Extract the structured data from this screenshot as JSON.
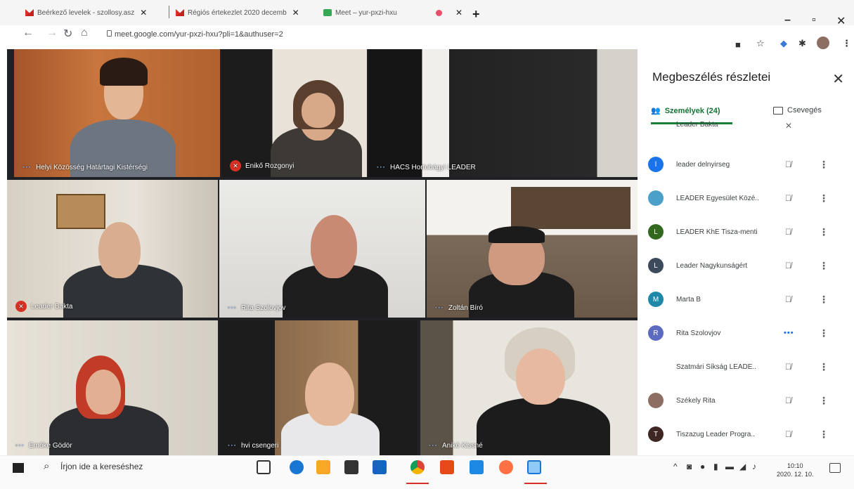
{
  "browser": {
    "tabs": [
      {
        "title": "Beérkező levelek - szollosy.asz",
        "icon": "gmail-icon"
      },
      {
        "title": "Régiós értekezlet 2020 decemb",
        "icon": "gmail-icon"
      },
      {
        "title": "Meet – yur-pxzi-hxu",
        "icon": "meet-icon"
      }
    ],
    "close_glyph": "✕",
    "new_tab_glyph": "+",
    "url": "meet.google.com/yur-pxzi-hxu?pli=1&authuser=2",
    "window_controls": [
      "–",
      "▫",
      "✕"
    ]
  },
  "meet": {
    "tiles": [
      {
        "name": "Helyi Közösség Határtagi Kistérségi",
        "indicator": "dots"
      },
      {
        "name": "Enikő Rozgonyi",
        "indicator": "muted"
      },
      {
        "name": "HACS Hortobágyi LEADER",
        "indicator": "dots"
      },
      {
        "name": "Leader Bakta",
        "indicator": "muted"
      },
      {
        "name": "Rita Szolovjov",
        "indicator": "dots"
      },
      {
        "name": "Zoltán Bíró",
        "indicator": "dots"
      },
      {
        "name": "Emőke Gödör",
        "indicator": "dots"
      },
      {
        "name": "hvi csengeri",
        "indicator": "dots"
      },
      {
        "name": "Anikó Kissné",
        "indicator": "dots"
      }
    ],
    "panel": {
      "title": "Megbeszélés részletei",
      "close_glyph": "✕",
      "tab_people": "Személyek (24)",
      "tab_chat": "Csevegés",
      "participants": [
        {
          "name": "Leader Bakta",
          "initial": "",
          "color": "#d93025",
          "status": "muted"
        },
        {
          "name": "leader delnyirseg",
          "initial": "l",
          "color": "#1a73e8",
          "status": "muted"
        },
        {
          "name": "LEADER Egyesület Közé..",
          "initial": "",
          "color": "#4aa0c8",
          "status": "muted"
        },
        {
          "name": "LEADER KhE Tisza-menti",
          "initial": "L",
          "color": "#33691e",
          "status": "muted"
        },
        {
          "name": "Leader Nagykunságért",
          "initial": "L",
          "color": "#3c4a5c",
          "status": "muted"
        },
        {
          "name": "Marta B",
          "initial": "M",
          "color": "#1e88a8",
          "status": "muted"
        },
        {
          "name": "Rita Szolovjov",
          "initial": "R",
          "color": "#5c6bc0",
          "status": "speaking"
        },
        {
          "name": "Szatmári Síkság LEADE..",
          "initial": "",
          "color": "#4db6ac",
          "status": "muted"
        },
        {
          "name": "Székely Rita",
          "initial": "",
          "color": "#8d6e63",
          "status": "muted"
        },
        {
          "name": "Tiszazug Leader Progra..",
          "initial": "T",
          "color": "#3e2723",
          "status": "muted"
        }
      ]
    }
  },
  "taskbar": {
    "search_placeholder": "Írjon ide a kereséshez",
    "time": "10:10",
    "date": "2020. 12. 10."
  }
}
